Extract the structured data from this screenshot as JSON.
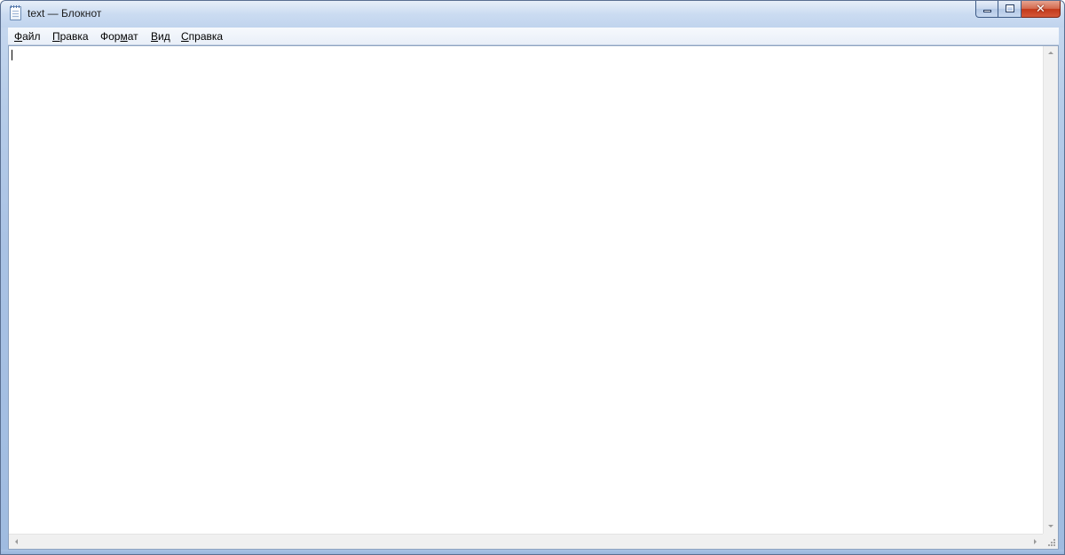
{
  "window": {
    "title": "text — Блокнот",
    "app_icon": "notepad-icon",
    "caption_buttons": {
      "minimize_icon": "minimize-icon",
      "maximize_icon": "maximize-icon",
      "close_glyph": "✕"
    }
  },
  "menubar": {
    "items": [
      {
        "underlined": "Ф",
        "rest": "айл"
      },
      {
        "underlined": "П",
        "rest": "равка"
      },
      {
        "pre": "Фор",
        "underlined": "м",
        "rest": "ат"
      },
      {
        "underlined": "В",
        "rest": "ид"
      },
      {
        "underlined": "С",
        "rest": "правка"
      }
    ]
  },
  "editor": {
    "content": ""
  },
  "colors": {
    "frame": "#a9c2e4",
    "close_button": "#c2391a",
    "editor_background": "#ffffff"
  }
}
